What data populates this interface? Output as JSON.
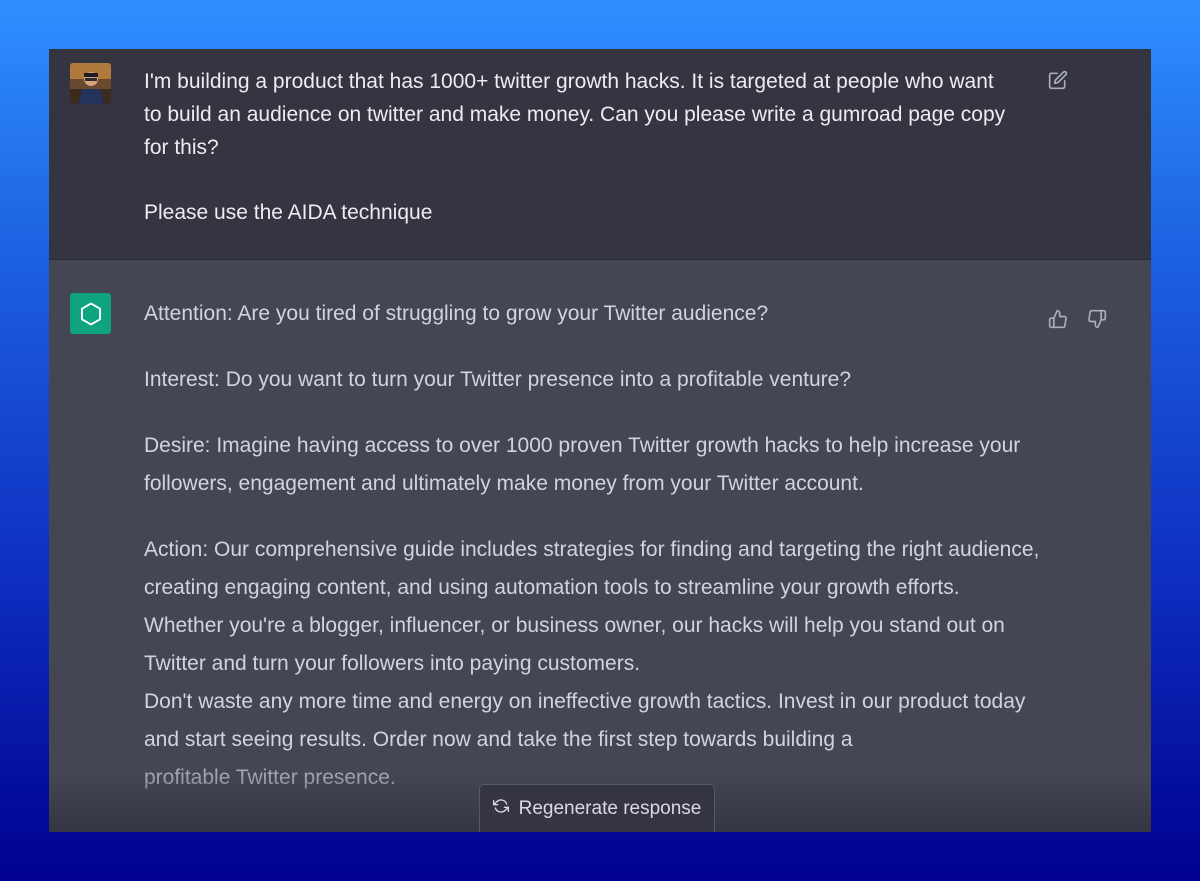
{
  "user_message": {
    "paragraphs": [
      "I'm building a product that has 1000+ twitter growth hacks. It is targeted at people who want to build an audience on twitter and make money. Can you please write a gumroad page copy for this?",
      "Please use the AIDA technique"
    ]
  },
  "assistant_message": {
    "attention": "Attention: Are you tired of struggling to grow your Twitter audience?",
    "interest": "Interest: Do you want to turn your Twitter presence into a profitable venture?",
    "desire": "Desire: Imagine having access to over 1000 proven Twitter growth hacks to help increase your followers, engagement and ultimately make money from your Twitter account.",
    "action": "Action: Our comprehensive guide includes strategies for finding and targeting the right audience, creating engaging content, and using automation tools to streamline your growth efforts. Whether you're a blogger, influencer, or business owner, our hacks will help you stand out on Twitter and turn your followers into paying customers.",
    "closing_main": "Don't waste any more time and energy on ineffective growth tactics. Invest in our product today and start seeing results. Order now and take the first step towards building a",
    "closing_tail": "profitable Twitter presence."
  },
  "regenerate": {
    "label": "Regenerate response"
  },
  "icons": {
    "edit": "edit-icon",
    "thumbs_up": "thumbs-up-icon",
    "thumbs_down": "thumbs-down-icon",
    "regenerate": "refresh-icon",
    "assistant_logo": "openai-logo-icon"
  },
  "colors": {
    "user_bg": "#343541",
    "assistant_bg": "#444654",
    "logo_bg": "#10a37f"
  }
}
